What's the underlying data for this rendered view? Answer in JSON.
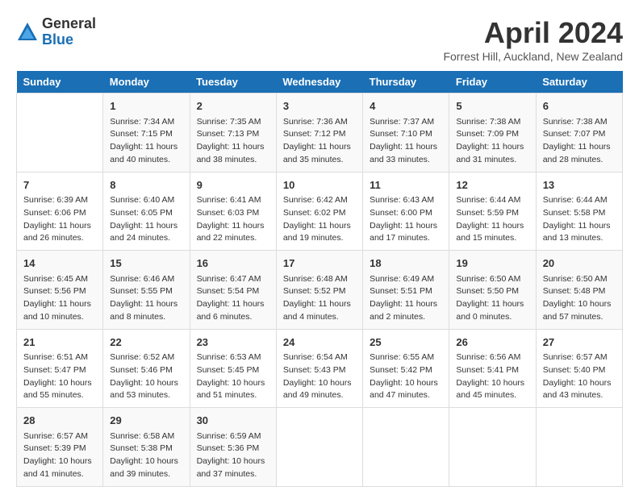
{
  "logo": {
    "general": "General",
    "blue": "Blue"
  },
  "title": "April 2024",
  "location": "Forrest Hill, Auckland, New Zealand",
  "headers": [
    "Sunday",
    "Monday",
    "Tuesday",
    "Wednesday",
    "Thursday",
    "Friday",
    "Saturday"
  ],
  "weeks": [
    [
      {
        "day": "",
        "sunrise": "",
        "sunset": "",
        "daylight": ""
      },
      {
        "day": "1",
        "sunrise": "Sunrise: 7:34 AM",
        "sunset": "Sunset: 7:15 PM",
        "daylight": "Daylight: 11 hours and 40 minutes."
      },
      {
        "day": "2",
        "sunrise": "Sunrise: 7:35 AM",
        "sunset": "Sunset: 7:13 PM",
        "daylight": "Daylight: 11 hours and 38 minutes."
      },
      {
        "day": "3",
        "sunrise": "Sunrise: 7:36 AM",
        "sunset": "Sunset: 7:12 PM",
        "daylight": "Daylight: 11 hours and 35 minutes."
      },
      {
        "day": "4",
        "sunrise": "Sunrise: 7:37 AM",
        "sunset": "Sunset: 7:10 PM",
        "daylight": "Daylight: 11 hours and 33 minutes."
      },
      {
        "day": "5",
        "sunrise": "Sunrise: 7:38 AM",
        "sunset": "Sunset: 7:09 PM",
        "daylight": "Daylight: 11 hours and 31 minutes."
      },
      {
        "day": "6",
        "sunrise": "Sunrise: 7:38 AM",
        "sunset": "Sunset: 7:07 PM",
        "daylight": "Daylight: 11 hours and 28 minutes."
      }
    ],
    [
      {
        "day": "7",
        "sunrise": "Sunrise: 6:39 AM",
        "sunset": "Sunset: 6:06 PM",
        "daylight": "Daylight: 11 hours and 26 minutes."
      },
      {
        "day": "8",
        "sunrise": "Sunrise: 6:40 AM",
        "sunset": "Sunset: 6:05 PM",
        "daylight": "Daylight: 11 hours and 24 minutes."
      },
      {
        "day": "9",
        "sunrise": "Sunrise: 6:41 AM",
        "sunset": "Sunset: 6:03 PM",
        "daylight": "Daylight: 11 hours and 22 minutes."
      },
      {
        "day": "10",
        "sunrise": "Sunrise: 6:42 AM",
        "sunset": "Sunset: 6:02 PM",
        "daylight": "Daylight: 11 hours and 19 minutes."
      },
      {
        "day": "11",
        "sunrise": "Sunrise: 6:43 AM",
        "sunset": "Sunset: 6:00 PM",
        "daylight": "Daylight: 11 hours and 17 minutes."
      },
      {
        "day": "12",
        "sunrise": "Sunrise: 6:44 AM",
        "sunset": "Sunset: 5:59 PM",
        "daylight": "Daylight: 11 hours and 15 minutes."
      },
      {
        "day": "13",
        "sunrise": "Sunrise: 6:44 AM",
        "sunset": "Sunset: 5:58 PM",
        "daylight": "Daylight: 11 hours and 13 minutes."
      }
    ],
    [
      {
        "day": "14",
        "sunrise": "Sunrise: 6:45 AM",
        "sunset": "Sunset: 5:56 PM",
        "daylight": "Daylight: 11 hours and 10 minutes."
      },
      {
        "day": "15",
        "sunrise": "Sunrise: 6:46 AM",
        "sunset": "Sunset: 5:55 PM",
        "daylight": "Daylight: 11 hours and 8 minutes."
      },
      {
        "day": "16",
        "sunrise": "Sunrise: 6:47 AM",
        "sunset": "Sunset: 5:54 PM",
        "daylight": "Daylight: 11 hours and 6 minutes."
      },
      {
        "day": "17",
        "sunrise": "Sunrise: 6:48 AM",
        "sunset": "Sunset: 5:52 PM",
        "daylight": "Daylight: 11 hours and 4 minutes."
      },
      {
        "day": "18",
        "sunrise": "Sunrise: 6:49 AM",
        "sunset": "Sunset: 5:51 PM",
        "daylight": "Daylight: 11 hours and 2 minutes."
      },
      {
        "day": "19",
        "sunrise": "Sunrise: 6:50 AM",
        "sunset": "Sunset: 5:50 PM",
        "daylight": "Daylight: 11 hours and 0 minutes."
      },
      {
        "day": "20",
        "sunrise": "Sunrise: 6:50 AM",
        "sunset": "Sunset: 5:48 PM",
        "daylight": "Daylight: 10 hours and 57 minutes."
      }
    ],
    [
      {
        "day": "21",
        "sunrise": "Sunrise: 6:51 AM",
        "sunset": "Sunset: 5:47 PM",
        "daylight": "Daylight: 10 hours and 55 minutes."
      },
      {
        "day": "22",
        "sunrise": "Sunrise: 6:52 AM",
        "sunset": "Sunset: 5:46 PM",
        "daylight": "Daylight: 10 hours and 53 minutes."
      },
      {
        "day": "23",
        "sunrise": "Sunrise: 6:53 AM",
        "sunset": "Sunset: 5:45 PM",
        "daylight": "Daylight: 10 hours and 51 minutes."
      },
      {
        "day": "24",
        "sunrise": "Sunrise: 6:54 AM",
        "sunset": "Sunset: 5:43 PM",
        "daylight": "Daylight: 10 hours and 49 minutes."
      },
      {
        "day": "25",
        "sunrise": "Sunrise: 6:55 AM",
        "sunset": "Sunset: 5:42 PM",
        "daylight": "Daylight: 10 hours and 47 minutes."
      },
      {
        "day": "26",
        "sunrise": "Sunrise: 6:56 AM",
        "sunset": "Sunset: 5:41 PM",
        "daylight": "Daylight: 10 hours and 45 minutes."
      },
      {
        "day": "27",
        "sunrise": "Sunrise: 6:57 AM",
        "sunset": "Sunset: 5:40 PM",
        "daylight": "Daylight: 10 hours and 43 minutes."
      }
    ],
    [
      {
        "day": "28",
        "sunrise": "Sunrise: 6:57 AM",
        "sunset": "Sunset: 5:39 PM",
        "daylight": "Daylight: 10 hours and 41 minutes."
      },
      {
        "day": "29",
        "sunrise": "Sunrise: 6:58 AM",
        "sunset": "Sunset: 5:38 PM",
        "daylight": "Daylight: 10 hours and 39 minutes."
      },
      {
        "day": "30",
        "sunrise": "Sunrise: 6:59 AM",
        "sunset": "Sunset: 5:36 PM",
        "daylight": "Daylight: 10 hours and 37 minutes."
      },
      {
        "day": "",
        "sunrise": "",
        "sunset": "",
        "daylight": ""
      },
      {
        "day": "",
        "sunrise": "",
        "sunset": "",
        "daylight": ""
      },
      {
        "day": "",
        "sunrise": "",
        "sunset": "",
        "daylight": ""
      },
      {
        "day": "",
        "sunrise": "",
        "sunset": "",
        "daylight": ""
      }
    ]
  ]
}
